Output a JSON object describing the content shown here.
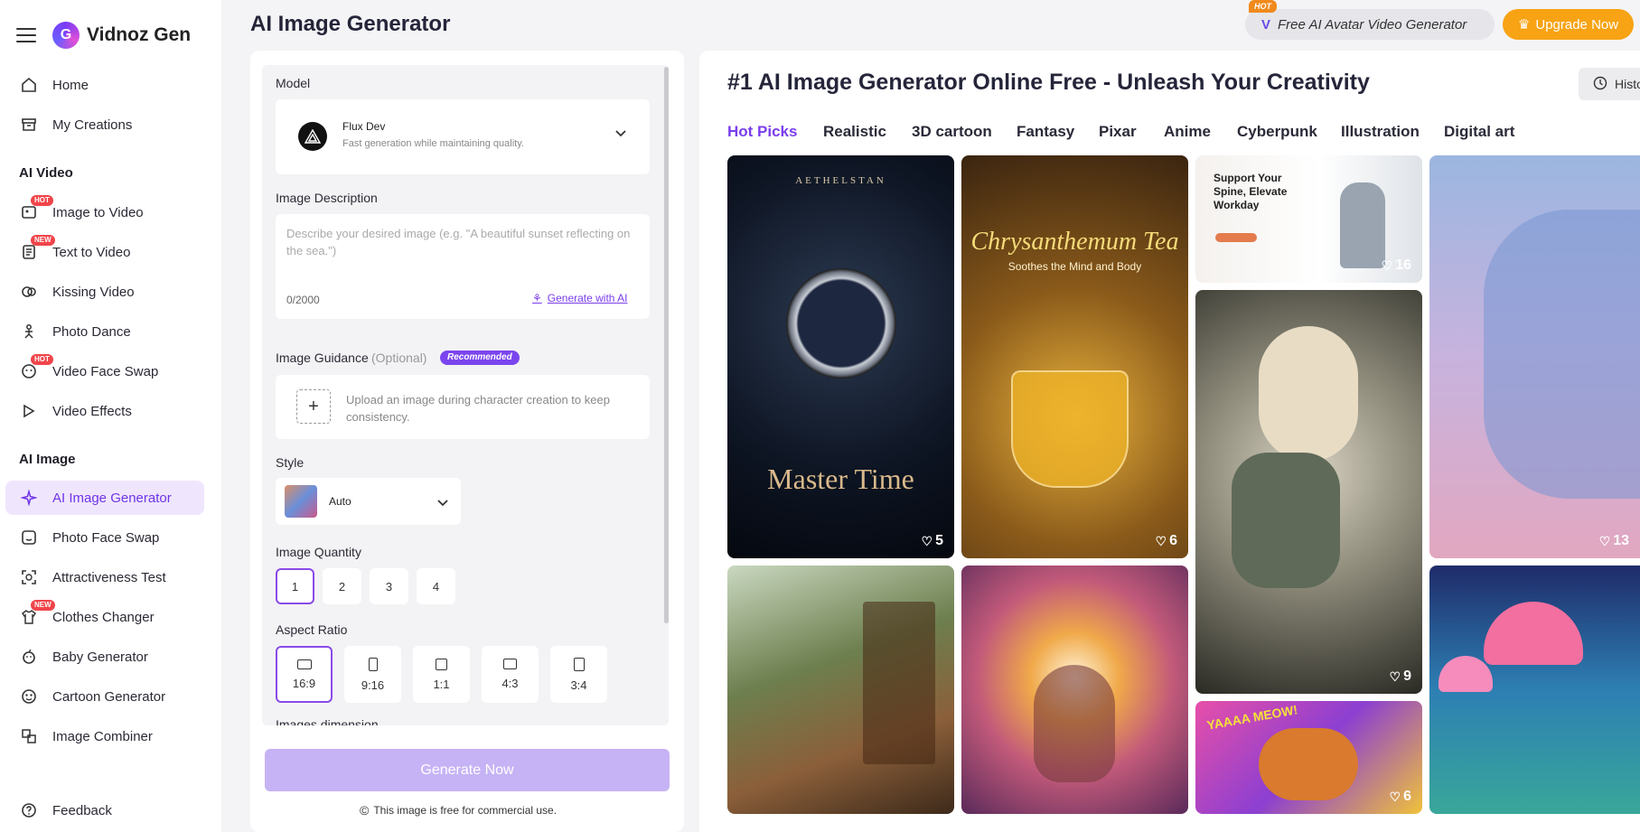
{
  "app": {
    "logo_text": "Vidnoz Gen",
    "page_title": "AI Image Generator"
  },
  "colors": {
    "accent": "#7a3eec",
    "upgrade": "#f7a314",
    "hot_badge": "#f0454a"
  },
  "sidebar": {
    "top_items": [
      {
        "label": "Home",
        "icon": "home-icon"
      },
      {
        "label": "My Creations",
        "icon": "archive-icon"
      }
    ],
    "sections": [
      {
        "title": "AI Video",
        "items": [
          {
            "label": "Image to Video",
            "icon": "image-video-icon",
            "badge": "HOT"
          },
          {
            "label": "Text to Video",
            "icon": "text-video-icon",
            "badge": "NEW"
          },
          {
            "label": "Kissing Video",
            "icon": "kiss-icon"
          },
          {
            "label": "Photo Dance",
            "icon": "dance-icon"
          },
          {
            "label": "Video Face Swap",
            "icon": "face-swap-icon",
            "badge": "HOT"
          },
          {
            "label": "Video Effects",
            "icon": "effects-icon"
          }
        ]
      },
      {
        "title": "AI Image",
        "items": [
          {
            "label": "AI Image Generator",
            "icon": "sparkle-icon",
            "active": true
          },
          {
            "label": "Photo Face Swap",
            "icon": "face-icon"
          },
          {
            "label": "Attractiveness Test",
            "icon": "scan-face-icon"
          },
          {
            "label": "Clothes Changer",
            "icon": "shirt-icon",
            "badge": "NEW"
          },
          {
            "label": "Baby Generator",
            "icon": "baby-icon"
          },
          {
            "label": "Cartoon Generator",
            "icon": "cartoon-icon"
          },
          {
            "label": "Image Combiner",
            "icon": "combine-icon"
          }
        ]
      }
    ],
    "feedback": "Feedback"
  },
  "header": {
    "promo_badge": "HOT",
    "promo_text": "Free AI Avatar Video Generator",
    "upgrade_label": "Upgrade Now"
  },
  "form": {
    "model_label": "Model",
    "model_name": "Flux Dev",
    "model_desc": "Fast generation while maintaining quality.",
    "desc_label": "Image Description",
    "desc_placeholder": "Describe your desired image (e.g. \"A beautiful sunset reflecting on the sea.\")",
    "desc_count": "0/2000",
    "generate_ai": "Generate with AI",
    "guidance_label": "Image Guidance",
    "guidance_optional": "(Optional)",
    "guidance_badge": "Recommended",
    "guidance_upload": "Upload an image during character creation to keep consistency.",
    "style_label": "Style",
    "style_value": "Auto",
    "quantity_label": "Image Quantity",
    "quantity_options": [
      "1",
      "2",
      "3",
      "4"
    ],
    "quantity_selected": "1",
    "ratio_label": "Aspect Ratio",
    "ratio_options": [
      "16:9",
      "9:16",
      "1:1",
      "4:3",
      "3:4"
    ],
    "ratio_selected": "16:9",
    "dimension_label": "Images dimension",
    "generate_button": "Generate Now",
    "commercial_note": "This image is free for commercial use."
  },
  "gallery": {
    "title": "#1 AI Image Generator Online Free - Unleash Your Creativity",
    "history_label": "Histo",
    "tabs": [
      "Hot Picks",
      "Realistic",
      "3D cartoon",
      "Fantasy",
      "Pixar",
      "Anime",
      "Cyberpunk",
      "Illustration",
      "Digital art"
    ],
    "active_tab": "Hot Picks",
    "cards": [
      {
        "name": "watch-card",
        "brand": "AETHELSTAN",
        "caption": "Master Time",
        "likes": "5"
      },
      {
        "name": "tea-card",
        "caption": "Chrysanthemum Tea",
        "subcaption": "Soothes the Mind and Body",
        "likes": "6"
      },
      {
        "name": "office-card",
        "caption": "Support Your Spine, Elevate Workday",
        "likes": "16"
      },
      {
        "name": "sky-face-card",
        "likes": "13"
      },
      {
        "name": "woman-dragon-card",
        "likes": "9"
      },
      {
        "name": "library-card",
        "likes": ""
      },
      {
        "name": "glowing-man-card",
        "likes": ""
      },
      {
        "name": "cats-card",
        "caption": "YAAAA MEOW!",
        "likes": "6"
      },
      {
        "name": "jellyfish-card",
        "likes": ""
      }
    ]
  }
}
